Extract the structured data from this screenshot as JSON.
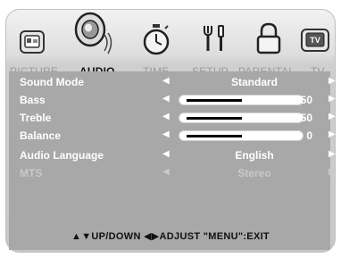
{
  "tabs": [
    {
      "label": "PICTURE",
      "icon": "picture-icon",
      "active": false
    },
    {
      "label": "AUDIO",
      "icon": "speaker-icon",
      "active": true
    },
    {
      "label": "TIME",
      "icon": "stopwatch-icon",
      "active": false
    },
    {
      "label": "SETUP",
      "icon": "tools-icon",
      "active": false
    },
    {
      "label": "PARENTAL",
      "icon": "lock-icon",
      "active": false
    },
    {
      "label": "TV",
      "icon": "tv-icon",
      "active": false
    }
  ],
  "menu": {
    "sound_mode": {
      "label": "Sound Mode",
      "value": "Standard"
    },
    "bass": {
      "label": "Bass",
      "value": "50",
      "level": 0.5
    },
    "treble": {
      "label": "Treble",
      "value": "50",
      "level": 0.5
    },
    "balance": {
      "label": "Balance",
      "value": "0",
      "level": 0.5
    },
    "audio_language": {
      "label": "Audio Language",
      "value": "English"
    },
    "mts": {
      "label": "MTS",
      "value": "Stereo",
      "disabled": true
    }
  },
  "arrows": {
    "left": "◀",
    "right": "▶"
  },
  "footer": {
    "hint": "▲▼UP/DOWN  ◀▶ADJUST  \"MENU\":EXIT"
  }
}
